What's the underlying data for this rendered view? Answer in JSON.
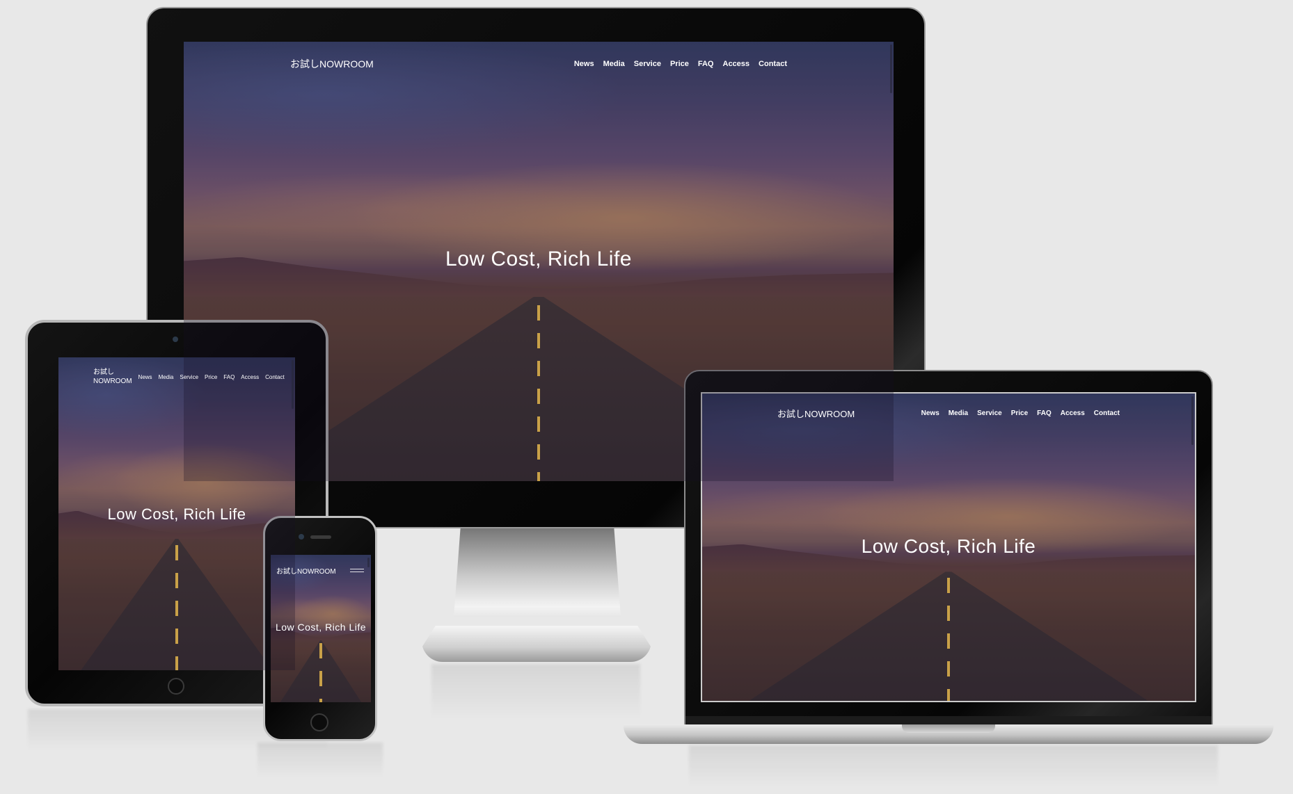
{
  "site": {
    "brand": "お試しNOWROOM",
    "brand_tablet_line1": "お試し",
    "brand_tablet_line2": "NOWROOM",
    "nav": [
      "News",
      "Media",
      "Service",
      "Price",
      "FAQ",
      "Access",
      "Contact"
    ],
    "hero_title": "Low Cost, Rich Life"
  },
  "devices": [
    "desktop",
    "laptop",
    "tablet",
    "phone"
  ],
  "colors": {
    "page_background": "#e8e8e8",
    "text": "#ffffff",
    "road_line": "#c9a148"
  },
  "icons": {
    "phone_menu": "hamburger-icon"
  }
}
